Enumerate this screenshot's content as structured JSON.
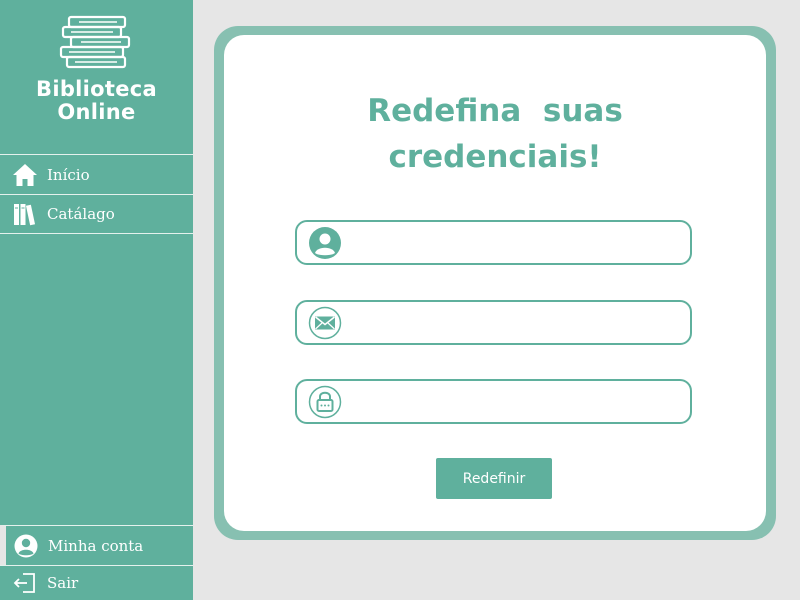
{
  "brand": {
    "title_line1": "Biblioteca",
    "title_line2": "Online",
    "logo_icon": "books-stack-icon"
  },
  "nav": {
    "items": [
      {
        "label": "Início",
        "icon": "home-icon"
      },
      {
        "label": "Catálago",
        "icon": "books-icon"
      }
    ],
    "bottom": [
      {
        "label": "Minha conta",
        "icon": "user-circle-icon"
      },
      {
        "label": "Sair",
        "icon": "logout-icon"
      }
    ]
  },
  "form": {
    "title_line1": "Redefina  suas",
    "title_line2": "credenciais!",
    "fields": [
      {
        "icon": "user-icon",
        "value": "",
        "placeholder": ""
      },
      {
        "icon": "email-icon",
        "value": "",
        "placeholder": ""
      },
      {
        "icon": "lock-icon",
        "value": "",
        "placeholder": ""
      }
    ],
    "submit_label": "Redefinir"
  },
  "colors": {
    "accent": "#5fb09d",
    "card_border": "#87c0b1",
    "background": "#e6e6e6",
    "card": "#ffffff"
  }
}
